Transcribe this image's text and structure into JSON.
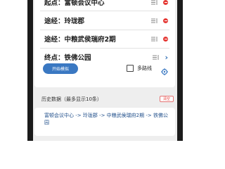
{
  "route": {
    "rows": [
      {
        "label": "起点：富顿会议中心",
        "action": "remove"
      },
      {
        "label": "途经：玲珑郡",
        "action": "remove"
      },
      {
        "label": "途经：中粮武侯瑞府2期",
        "action": "remove"
      },
      {
        "label": "终点：铁佛公园",
        "action": "open"
      }
    ]
  },
  "controls": {
    "start_label": "开始模拟",
    "multi_route_label": "多路线",
    "multi_route_checked": false
  },
  "history": {
    "title": "历史数据（最多显示10条）",
    "clear_label": "清空",
    "items": [
      "富顿会议中心 -> 玲珑郡 -> 中粮武侯瑞府2期 -> 铁佛公园"
    ]
  },
  "colors": {
    "accent": "#3a78c2",
    "danger": "#e53935",
    "background": "#eeeeee"
  }
}
